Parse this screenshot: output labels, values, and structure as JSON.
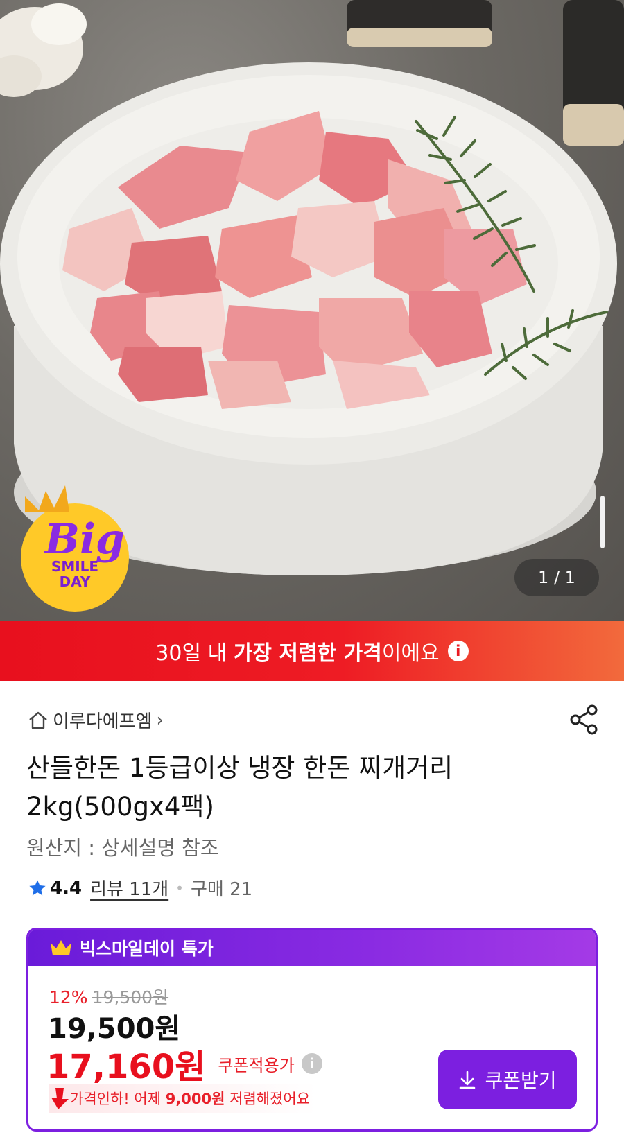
{
  "gallery": {
    "counter": "1 / 1",
    "badge": {
      "big": "Big",
      "smile": "SMILE",
      "day": "DAY"
    }
  },
  "banner": {
    "prefix": "30일 내 ",
    "highlight": "가장 저렴한 가격",
    "suffix": "이에요",
    "info_icon": "i"
  },
  "seller": {
    "name": "이루다에프엠",
    "chevron": "›"
  },
  "product": {
    "title": "산들한돈 1등급이상 냉장 한돈 찌개거리 2kg(500gx4팩)",
    "origin": "원산지 : 상세설명 참조",
    "rating": "4.4",
    "reviews": "리뷰 11개",
    "purchases": "구매 21"
  },
  "promo": {
    "header": "빅스마일데이 특가",
    "discount_pct": "12%",
    "original_price": "19,500원",
    "price": "19,500원",
    "sale_price": "17,160원",
    "sale_label": "쿠폰적용가",
    "drop_prefix": "가격인하! 어제 ",
    "drop_amount": "9,000원",
    "drop_suffix": " 저렴해졌어요",
    "coupon_button": "쿠폰받기"
  },
  "colors": {
    "accent_purple": "#7c1fe0",
    "banner_red": "#ee1c24",
    "sale_red": "#e8101e"
  },
  "icons": [
    "home-icon",
    "share-icon",
    "star-icon",
    "crown-icon",
    "info-icon",
    "download-icon",
    "arrow-down-icon"
  ]
}
